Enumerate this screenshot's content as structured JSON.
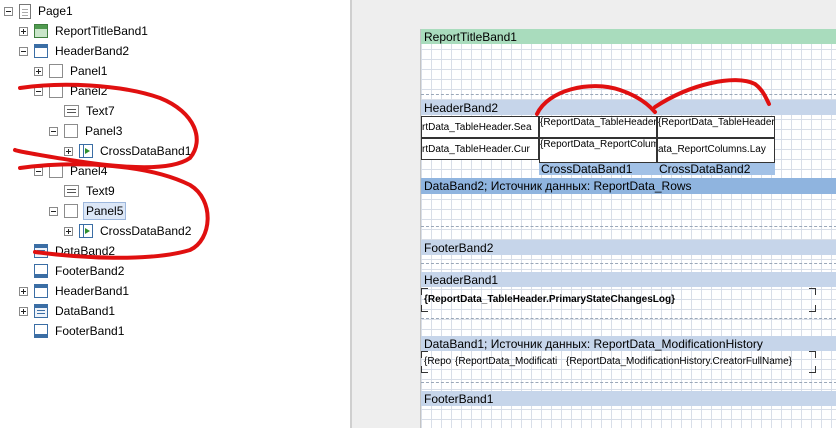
{
  "tree": {
    "items": [
      {
        "label": "Page1"
      },
      {
        "label": "ReportTitleBand1"
      },
      {
        "label": "HeaderBand2"
      },
      {
        "label": "Panel1"
      },
      {
        "label": "Panel2"
      },
      {
        "label": "Text7"
      },
      {
        "label": "Panel3"
      },
      {
        "label": "CrossDataBand1"
      },
      {
        "label": "Panel4"
      },
      {
        "label": "Text9"
      },
      {
        "label": "Panel5"
      },
      {
        "label": "CrossDataBand2"
      },
      {
        "label": "DataBand2"
      },
      {
        "label": "FooterBand2"
      },
      {
        "label": "HeaderBand1"
      },
      {
        "label": "DataBand1"
      },
      {
        "label": "FooterBand1"
      }
    ]
  },
  "canvas": {
    "bands": {
      "report_title": "ReportTitleBand1",
      "header2": "HeaderBand2",
      "data2": "DataBand2; Источник данных: ReportData_Rows",
      "footer2": "FooterBand2",
      "header1": "HeaderBand1",
      "data1": "DataBand1; Источник данных: ReportData_ModificationHistory",
      "footer1": "FooterBand1"
    },
    "fields": {
      "header_sea": "rtData_TableHeader.Sea",
      "header_cur": "rtData_TableHeader.Cur",
      "first_year": "{ReportData_TableHeader.FirstYearTitle}",
      "second_year": "{ReportData_TableHeader.SecondYearTitle}",
      "columns_layer": "{ReportData_ReportColumns.LayerName}",
      "columns_layer_cut": "ata_ReportColumns.Lay",
      "cross1": "CrossDataBand1",
      "cross2": "CrossDataBand2",
      "primary_log": "{ReportData_TableHeader.PrimaryStateChangesLog}",
      "hist_repo": "{Repo",
      "hist_modif": "{ReportData_Modificati",
      "hist_creator": "{ReportData_ModificationHistory.CreatorFullName}"
    }
  },
  "colors": {
    "title_band": "#a9dcbd",
    "band": "#c6d5ea",
    "data_band": "#8fb4df",
    "selection": "#dce7f7",
    "annotation": "#e01010"
  }
}
